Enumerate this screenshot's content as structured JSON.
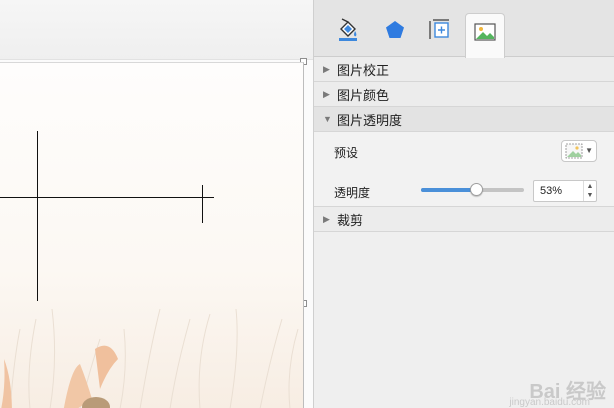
{
  "sidebar": {
    "tabs": [
      {
        "name": "fill-paint-bucket-icon"
      },
      {
        "name": "shape-pentagon-icon"
      },
      {
        "name": "size-position-icon"
      },
      {
        "name": "picture-format-icon"
      }
    ],
    "sections": {
      "correction": "图片校正",
      "color": "图片颜色",
      "transparency": "图片透明度",
      "crop": "裁剪"
    },
    "transparency_panel": {
      "preset_label": "预设",
      "transparency_label": "透明度",
      "transparency_value": "53%",
      "slider_fraction": 0.53
    }
  },
  "colors": {
    "accent": "#4a90d9",
    "pentagon": "#2f7be0"
  },
  "watermark": {
    "brand": "Bai 经验",
    "site": "jingyan.baidu.com"
  }
}
